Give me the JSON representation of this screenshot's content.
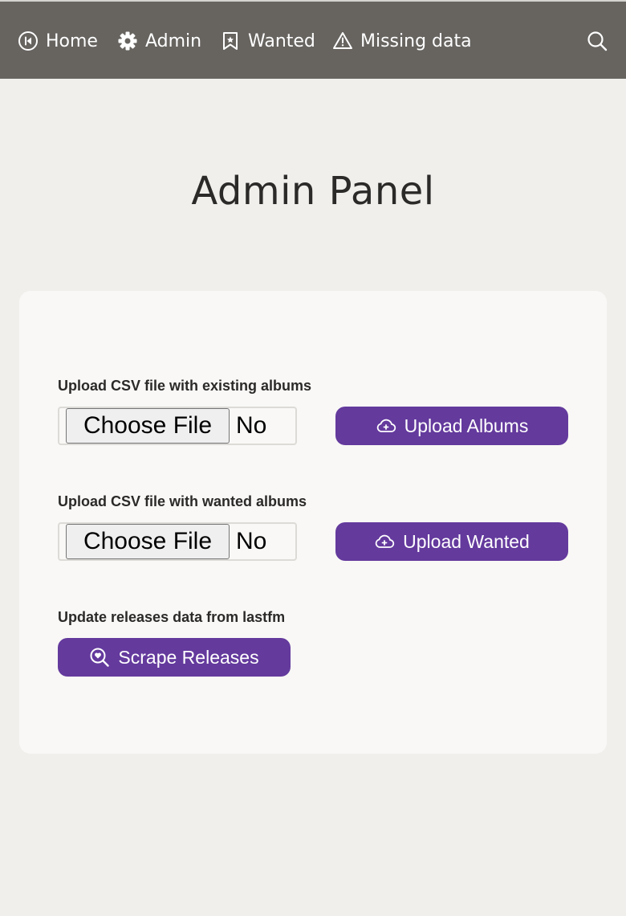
{
  "nav": {
    "home": {
      "label": "Home",
      "icon": "home-icon"
    },
    "admin": {
      "label": "Admin",
      "icon": "gear-icon"
    },
    "wanted": {
      "label": "Wanted",
      "icon": "bookmark-icon"
    },
    "missing": {
      "label": "Missing data",
      "icon": "warning-icon"
    },
    "search": {
      "icon": "search-icon"
    }
  },
  "page": {
    "title": "Admin Panel"
  },
  "sections": {
    "existing": {
      "label": "Upload CSV file with existing albums",
      "choose_label": "Choose File",
      "file_status": "No",
      "button_label": "Upload Albums",
      "button_icon": "cloud-upload-icon"
    },
    "wanted": {
      "label": "Upload CSV file with wanted albums",
      "choose_label": "Choose File",
      "file_status": "No",
      "button_label": "Upload Wanted",
      "button_icon": "cloud-upload-icon"
    },
    "scrape": {
      "label": "Update releases data from lastfm",
      "button_label": "Scrape Releases",
      "button_icon": "search-heart-icon"
    }
  },
  "colors": {
    "topbar": "#676460",
    "background": "#f0efec",
    "card": "#f9f8f6",
    "accent": "#643a9d"
  }
}
